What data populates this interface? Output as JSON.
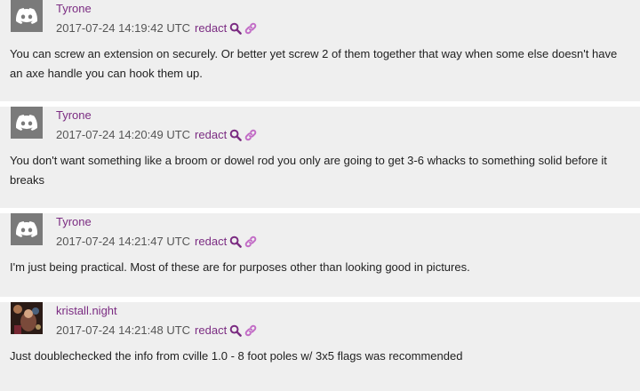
{
  "messages": [
    {
      "username": "Tyrone",
      "timestamp": "2017-07-24 14:19:42 UTC",
      "redact_label": "redact",
      "text": "You can screw an extension on securely. Or better yet screw 2 of them together that way when some else doesn't have an axe handle you can hook them up.",
      "avatar": "discord-logo-icon"
    },
    {
      "username": "Tyrone",
      "timestamp": "2017-07-24 14:20:49 UTC",
      "redact_label": "redact",
      "text": "You don't want something like a broom or dowel rod you only are going to get 3-6 whacks to something solid before it breaks",
      "avatar": "discord-logo-icon"
    },
    {
      "username": "Tyrone",
      "timestamp": "2017-07-24 14:21:47 UTC",
      "redact_label": "redact",
      "text": "I'm just being practical. Most of these are for purposes other than looking good in pictures.",
      "avatar": "discord-logo-icon"
    },
    {
      "username": "kristall.night",
      "timestamp": "2017-07-24 14:21:48 UTC",
      "redact_label": "redact",
      "text": "Just doublechecked the info from cville 1.0 - 8 foot poles w/ 3x5 flags was recommended",
      "avatar": "user-photo-avatar"
    }
  ],
  "colors": {
    "username": "#7b2c82",
    "link": "#7b2c82",
    "card_background": "#efefef",
    "avatar_gray": "#7a7a7a"
  }
}
